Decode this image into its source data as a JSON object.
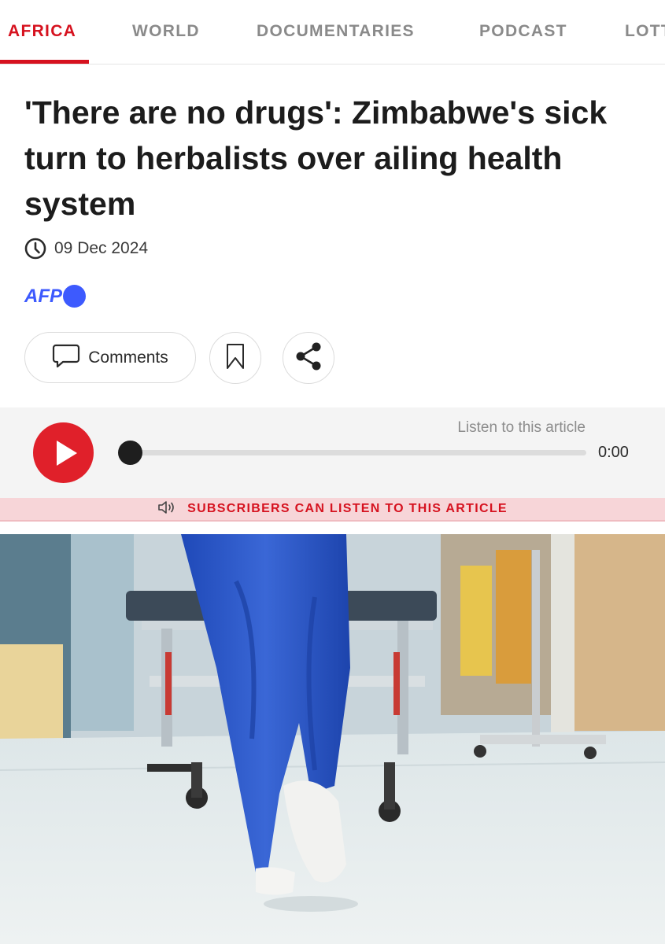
{
  "nav": {
    "tabs": [
      {
        "label": "AFRICA",
        "active": true
      },
      {
        "label": "WORLD",
        "active": false
      },
      {
        "label": "DOCUMENTARIES",
        "active": false
      },
      {
        "label": "PODCAST",
        "active": false
      },
      {
        "label": "LOTTO",
        "active": false
      }
    ]
  },
  "article": {
    "headline": "'There are no drugs': Zimbabwe's sick turn to herbalists over ailing health system",
    "date": "09 Dec 2024",
    "source_logo": "AFP"
  },
  "actions": {
    "comments_label": "Comments",
    "comment_icon": "speech-bubble-icon",
    "bookmark_icon": "bookmark-icon",
    "share_icon": "share-icon"
  },
  "player": {
    "listen_label": "Listen to this article",
    "time": "0:00",
    "progress": 0,
    "play_icon": "play-icon"
  },
  "subscribers_banner": {
    "text": "SUBSCRIBERS CAN LISTEN TO THIS ARTICLE",
    "icon": "speaker-icon"
  },
  "hero_image": {
    "description_icon": "hospital-corridor-photo"
  },
  "colors": {
    "accent": "#d6121f",
    "afp_blue": "#3d5afe",
    "play_red": "#e0202a",
    "banner_pink": "#f7d5d8"
  }
}
